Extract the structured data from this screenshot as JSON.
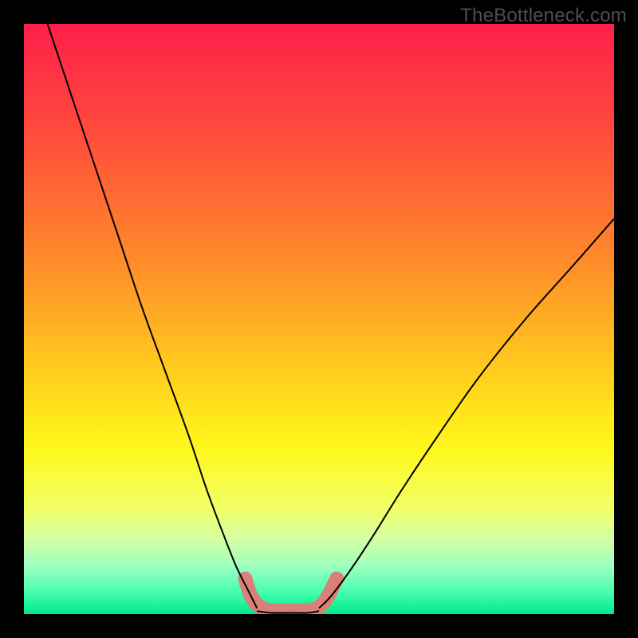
{
  "watermark": "TheBottleneck.com",
  "chart_data": {
    "type": "line",
    "title": "",
    "xlabel": "",
    "ylabel": "",
    "xlim": [
      0,
      100
    ],
    "ylim": [
      0,
      100
    ],
    "gradient_stops": [
      {
        "offset": 0,
        "color": "#ff1f4a"
      },
      {
        "offset": 18,
        "color": "#ff4a3d"
      },
      {
        "offset": 40,
        "color": "#ff8a2a"
      },
      {
        "offset": 60,
        "color": "#ffd11c"
      },
      {
        "offset": 72,
        "color": "#fff81c"
      },
      {
        "offset": 82,
        "color": "#f2ff66"
      },
      {
        "offset": 87,
        "color": "#d6ffa0"
      },
      {
        "offset": 92,
        "color": "#9dffc0"
      },
      {
        "offset": 96,
        "color": "#4bffb0"
      },
      {
        "offset": 100,
        "color": "#00e88a"
      }
    ],
    "series": [
      {
        "name": "left-branch",
        "x": [
          4,
          8,
          12,
          16,
          20,
          24,
          28,
          31,
          34,
          36,
          38,
          39.5
        ],
        "y": [
          100,
          88,
          76,
          64,
          52,
          41,
          30,
          21,
          13,
          8,
          4,
          1
        ]
      },
      {
        "name": "right-branch",
        "x": [
          50,
          52,
          55,
          59,
          64,
          70,
          77,
          85,
          93,
          100
        ],
        "y": [
          1,
          3,
          7,
          13,
          21,
          30,
          40,
          50,
          59,
          67
        ]
      },
      {
        "name": "bottom-flat",
        "x": [
          39.5,
          42,
          45,
          48,
          50
        ],
        "y": [
          0.5,
          0.2,
          0.2,
          0.2,
          0.5
        ]
      }
    ],
    "highlight_band": {
      "name": "bottom-highlight",
      "color": "#d98078",
      "thickness": 18,
      "points_x": [
        37.5,
        38.5,
        40,
        42,
        45,
        48,
        50,
        51.5,
        53
      ],
      "points_y": [
        6,
        3,
        1.2,
        0.6,
        0.5,
        0.6,
        1.2,
        3,
        6
      ]
    }
  }
}
